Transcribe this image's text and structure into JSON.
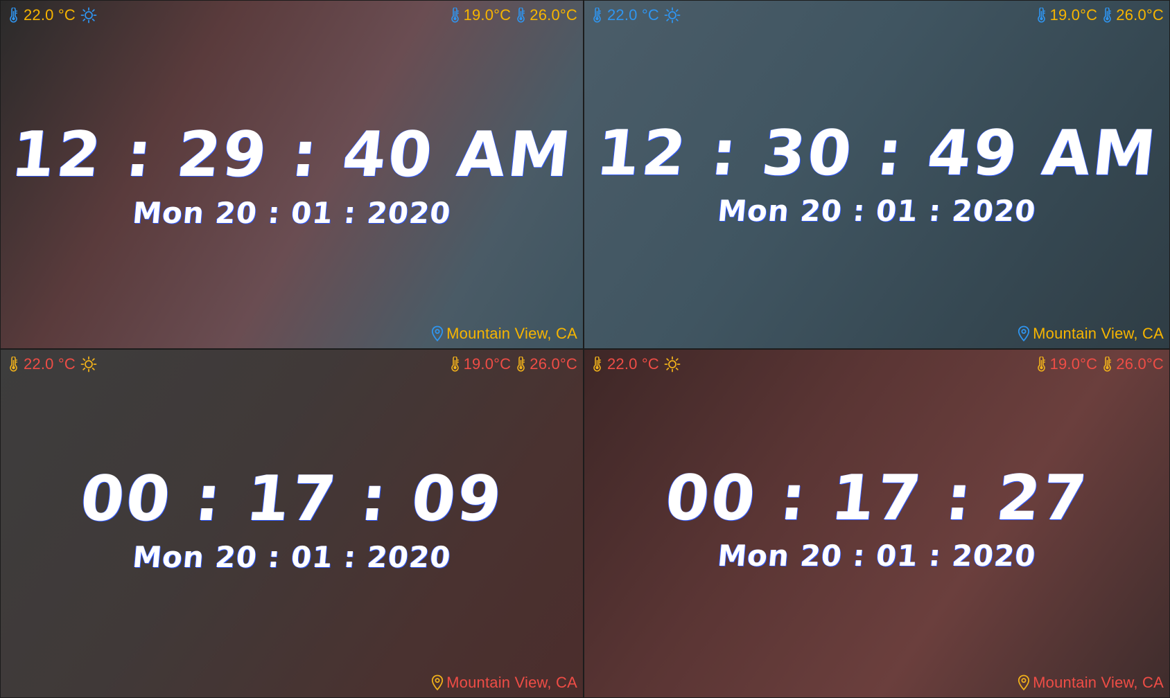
{
  "panels": [
    {
      "weather": {
        "current": "22.0 °C",
        "min": "19.0°C",
        "max": "26.0°C",
        "location": "Mountain View, CA"
      },
      "clock": {
        "time": "12 : 29 : 40 AM",
        "date": "Mon 20 : 01 : 2020"
      },
      "colors": {
        "icon": "#2f95f0",
        "text_left": "#f7b500",
        "min": "#f7b500",
        "max": "#f7b500",
        "location_icon": "#2f95f0",
        "location_text": "#f7b500"
      }
    },
    {
      "weather": {
        "current": "22.0 °C",
        "min": "19.0°C",
        "max": "26.0°C",
        "location": "Mountain View, CA"
      },
      "clock": {
        "time": "12 : 30 : 49 AM",
        "date": "Mon 20 : 01 : 2020"
      },
      "colors": {
        "icon": "#2f95f0",
        "text_left": "#2f95f0",
        "min": "#f7b500",
        "max": "#f7b500",
        "location_icon": "#2f95f0",
        "location_text": "#f7b500"
      }
    },
    {
      "weather": {
        "current": "22.0 °C",
        "min": "19.0°C",
        "max": "26.0°C",
        "location": "Mountain View, CA"
      },
      "clock": {
        "time": "00 : 17 : 09",
        "date": "Mon 20 : 01 : 2020"
      },
      "colors": {
        "icon": "#f0b11b",
        "text_left": "#ef4d46",
        "min": "#ef4d46",
        "max": "#ef4d46",
        "location_icon": "#f0b11b",
        "location_text": "#ef4d46"
      }
    },
    {
      "weather": {
        "current": "22.0 °C",
        "min": "19.0°C",
        "max": "26.0°C",
        "location": "Mountain View, CA"
      },
      "clock": {
        "time": "00 : 17 : 27",
        "date": "Mon 20 : 01 : 2020"
      },
      "colors": {
        "icon": "#f0b11b",
        "text_left": "#ef4d46",
        "min": "#ef4d46",
        "max": "#ef4d46",
        "location_icon": "#f0b11b",
        "location_text": "#ef4d46"
      }
    }
  ]
}
